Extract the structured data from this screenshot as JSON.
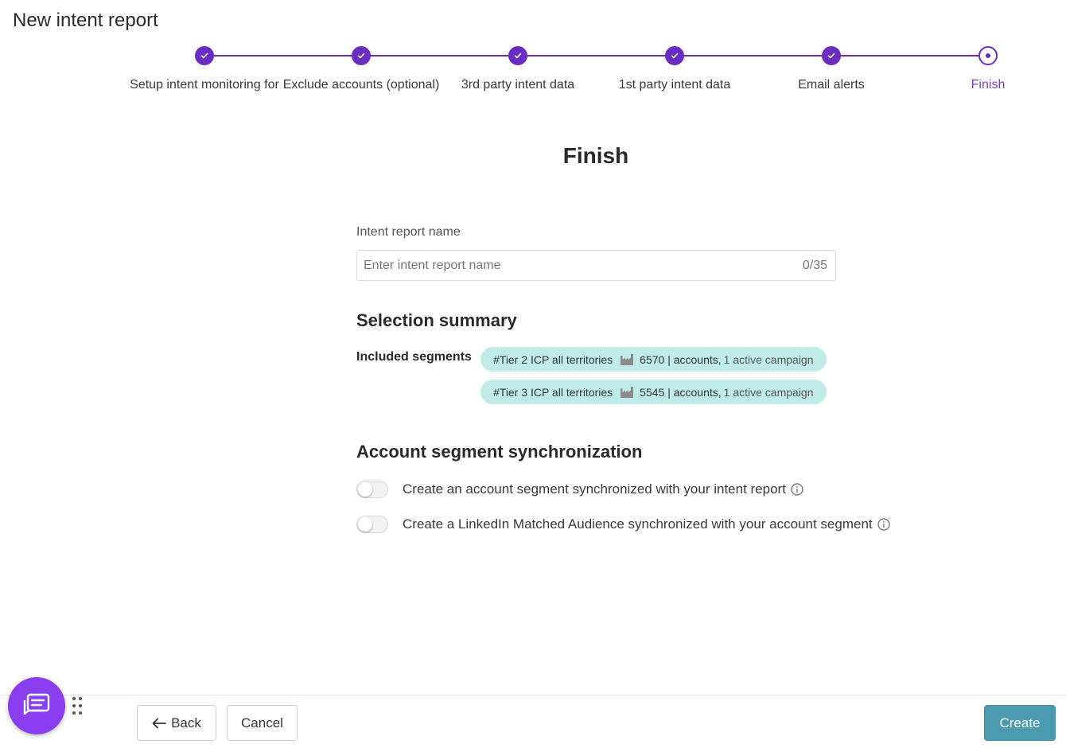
{
  "page": {
    "title": "New intent report"
  },
  "stepper": {
    "steps": [
      {
        "label": "Setup intent monitoring for",
        "state": "done"
      },
      {
        "label": "Exclude accounts (optional)",
        "state": "done"
      },
      {
        "label": "3rd party intent data",
        "state": "done"
      },
      {
        "label": "1st party intent data",
        "state": "done"
      },
      {
        "label": "Email alerts",
        "state": "done"
      },
      {
        "label": "Finish",
        "state": "current"
      }
    ],
    "accent_color": "#6a2cc2"
  },
  "finish": {
    "heading": "Finish",
    "name_field": {
      "label": "Intent report name",
      "placeholder": "Enter intent report name",
      "value": "",
      "counter": "0/35"
    }
  },
  "summary": {
    "heading": "Selection summary",
    "included_label": "Included segments",
    "segments": [
      {
        "name": "#Tier 2 ICP all territories",
        "icon": "industry-icon",
        "stats": "6570 | accounts,",
        "campaigns": "1 active campaign"
      },
      {
        "name": "#Tier 3 ICP all territories",
        "icon": "industry-icon",
        "stats": "5545 | accounts,",
        "campaigns": "1 active campaign"
      }
    ],
    "chip_color": "#bfece8"
  },
  "sync": {
    "heading": "Account segment synchronization",
    "options": [
      {
        "label": "Create an account segment synchronized with your intent report",
        "enabled": false,
        "icon": "info-icon"
      },
      {
        "label": "Create a LinkedIn Matched Audience synchronized with your account segment",
        "enabled": false,
        "icon": "info-icon"
      }
    ]
  },
  "footer": {
    "back_label": "Back",
    "cancel_label": "Cancel",
    "create_label": "Create",
    "create_color": "#4a9bb0"
  },
  "chat": {
    "icon": "chat-icon",
    "color": "#8b3df0"
  }
}
